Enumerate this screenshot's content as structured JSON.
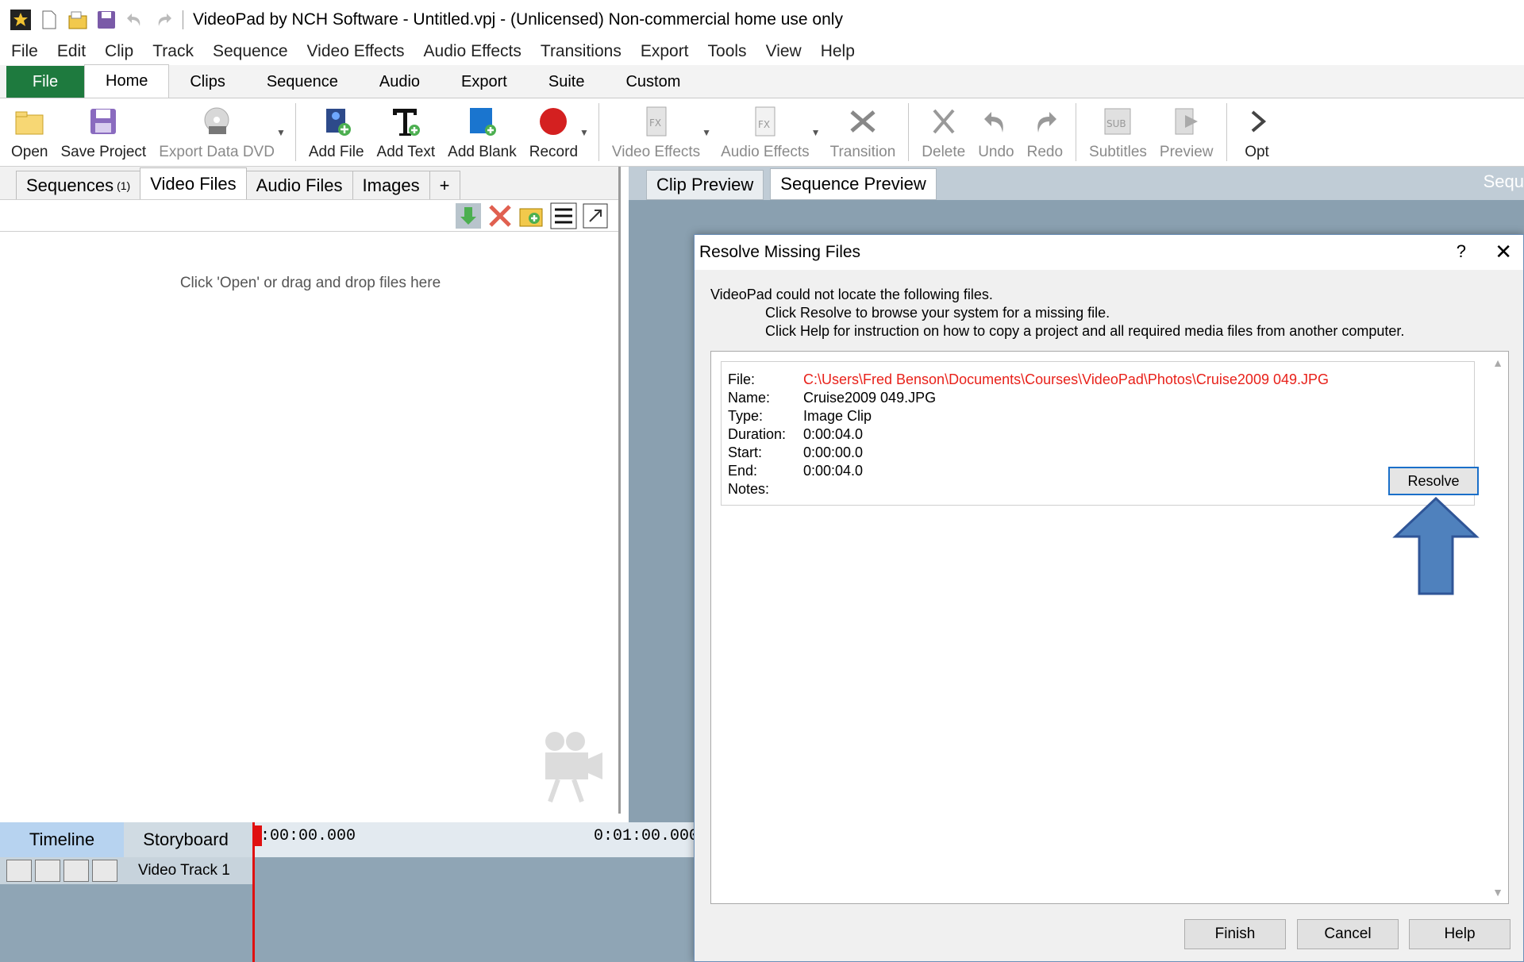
{
  "window": {
    "title": "VideoPad by NCH Software - Untitled.vpj - (Unlicensed) Non-commercial home use only"
  },
  "menu": [
    "File",
    "Edit",
    "Clip",
    "Track",
    "Sequence",
    "Video Effects",
    "Audio Effects",
    "Transitions",
    "Export",
    "Tools",
    "View",
    "Help"
  ],
  "ribbon_tabs": [
    "File",
    "Home",
    "Clips",
    "Sequence",
    "Audio",
    "Export",
    "Suite",
    "Custom"
  ],
  "toolbar": {
    "open": "Open",
    "save_project": "Save Project",
    "export_dvd": "Export Data DVD",
    "add_file": "Add File",
    "add_text": "Add Text",
    "add_blank": "Add Blank",
    "record": "Record",
    "video_effects": "Video Effects",
    "audio_effects": "Audio Effects",
    "transition": "Transition",
    "delete": "Delete",
    "undo": "Undo",
    "redo": "Redo",
    "subtitles": "Subtitles",
    "preview": "Preview",
    "options": "Opt"
  },
  "left_panel": {
    "tabs": {
      "sequences": "Sequences",
      "sequences_count": "(1)",
      "video_files": "Video Files",
      "audio_files": "Audio Files",
      "images": "Images",
      "add": "+"
    },
    "empty_hint": "Click 'Open' or drag and drop files here"
  },
  "preview": {
    "clip_tab": "Clip Preview",
    "sequence_tab": "Sequence Preview",
    "sequence_label": "Sequ"
  },
  "timeline": {
    "timeline_tab": "Timeline",
    "storyboard_tab": "Storyboard",
    "time_start": ":00:00.000",
    "time_mark": "0:01:00.000",
    "track_name": "Video Track 1"
  },
  "dialog": {
    "title": "Resolve Missing Files",
    "help_glyph": "?",
    "close_glyph": "✕",
    "message_line1": "VideoPad could not locate the following files.",
    "message_line2": "Click Resolve to browse your system for a missing file.",
    "message_line3": "Click Help for instruction on how to copy a project and all required media files from another computer.",
    "file": {
      "file_label": "File:",
      "file_value": "C:\\Users\\Fred Benson\\Documents\\Courses\\VideoPad\\Photos\\Cruise2009 049.JPG",
      "name_label": "Name:",
      "name_value": "Cruise2009 049.JPG",
      "type_label": "Type:",
      "type_value": "Image Clip",
      "duration_label": "Duration:",
      "duration_value": "0:00:04.0",
      "start_label": "Start:",
      "start_value": "0:00:00.0",
      "end_label": "End:",
      "end_value": "0:00:04.0",
      "notes_label": "Notes:"
    },
    "resolve_label": "Resolve",
    "finish_label": "Finish",
    "cancel_label": "Cancel",
    "help_label": "Help"
  },
  "colors": {
    "file_tab": "#1e7a3e",
    "missing_path": "#e8211a",
    "annotation_arrow": "#4f81bd",
    "record": "#d42020"
  }
}
